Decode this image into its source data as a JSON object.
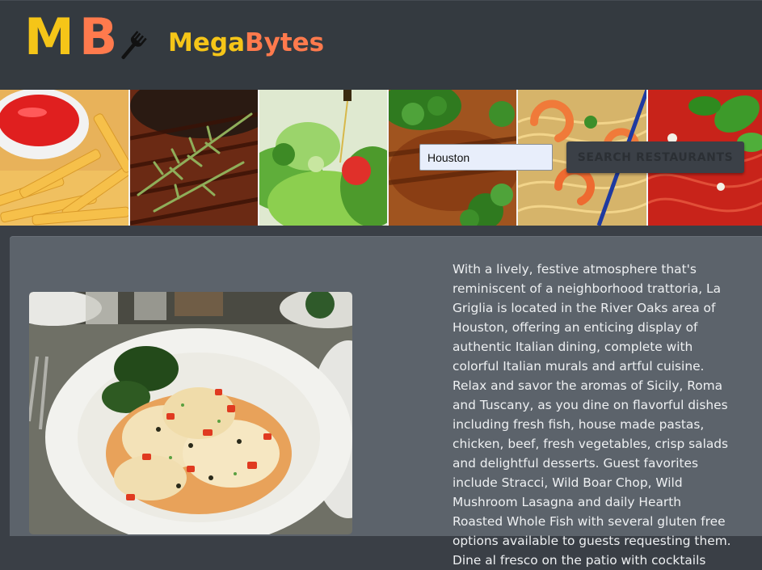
{
  "brand": {
    "logo_letters": "MB",
    "name_part1": "Mega",
    "name_part2": "Bytes",
    "logo_icon": "fork-icon",
    "colors": {
      "yellow": "#f5c518",
      "orange": "#ff7a4d"
    }
  },
  "banner": {
    "tiles": [
      "french-fries",
      "grilled-steak",
      "salad",
      "steak-broccoli",
      "shrimp-noodles",
      "pasta-basil"
    ]
  },
  "search": {
    "input_value": "Houston",
    "button_label": "SEARCH RESTAURANTS"
  },
  "restaurant": {
    "photo": "fish-artichoke-dish-image",
    "description": "With a lively, festive atmosphere that's reminiscent of a neighborhood trattoria, La Griglia is located in the River Oaks area of Houston, offering an enticing display of authentic Italian dining, complete with colorful Italian murals and artful cuisine. Relax and savor the aromas of Sicily, Roma and Tuscany, as you dine on flavorful dishes including fresh fish, house made pastas, chicken, beef, fresh vegetables, crisp salads and delightful desserts. Guest favorites include Stracci, Wild Boar Chop, Wild Mushroom Lasagna and daily Hearth Roasted Whole Fish with several gluten free options available to guests requesting them. Dine al fresco on the patio with cocktails"
  }
}
